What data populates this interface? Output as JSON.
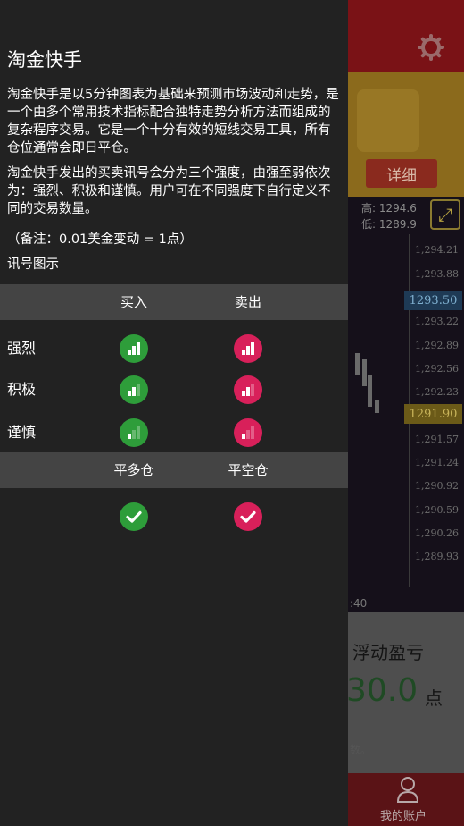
{
  "background": {
    "detail_button": "详细",
    "high_label": "高: 1294.6",
    "low_label": "低: 1289.9",
    "price_ticks": [
      "1,294.21",
      "1,293.88",
      "1,293.22",
      "1,292.89",
      "1,292.56",
      "1,292.23",
      "1,291.57",
      "1,291.24",
      "1,290.92",
      "1,290.59",
      "1,290.26",
      "1,289.93"
    ],
    "current_price_blue": "1293.50",
    "current_price_gold": "1291.90",
    "time_label": ":40",
    "floating_pl_label": "浮动盈亏",
    "floating_pl_value": "30.0",
    "floating_pl_unit": "点",
    "faded_note": "数。",
    "account_label": "我的账户"
  },
  "drawer": {
    "title": "淘金快手",
    "paragraph1": "淘金快手是以5分钟图表为基础来预测市场波动和走势，是一个由多个常用技术指标配合独特走势分析方法而组成的复杂程序交易。它是一个十分有效的短线交易工具，所有仓位通常会即日平仓。",
    "paragraph2": "淘金快手发出的买卖讯号会分为三个强度，由强至弱依次为：强烈、积极和谨慎。用户可在不同强度下自行定义不同的交易数量。",
    "note": "（备注：0.01美金变动 = 1点）",
    "legend_title": "讯号图示",
    "header1": {
      "buy": "买入",
      "sell": "卖出"
    },
    "rows": [
      {
        "label": "强烈",
        "bars": 3
      },
      {
        "label": "积极",
        "bars": 2
      },
      {
        "label": "谨慎",
        "bars": 1
      }
    ],
    "header2": {
      "close_long": "平多仓",
      "close_short": "平空仓"
    }
  },
  "colors": {
    "buy": "#2e9d3a",
    "sell": "#d8205a",
    "drawer_bg": "#222222",
    "header_bg": "#444444"
  }
}
